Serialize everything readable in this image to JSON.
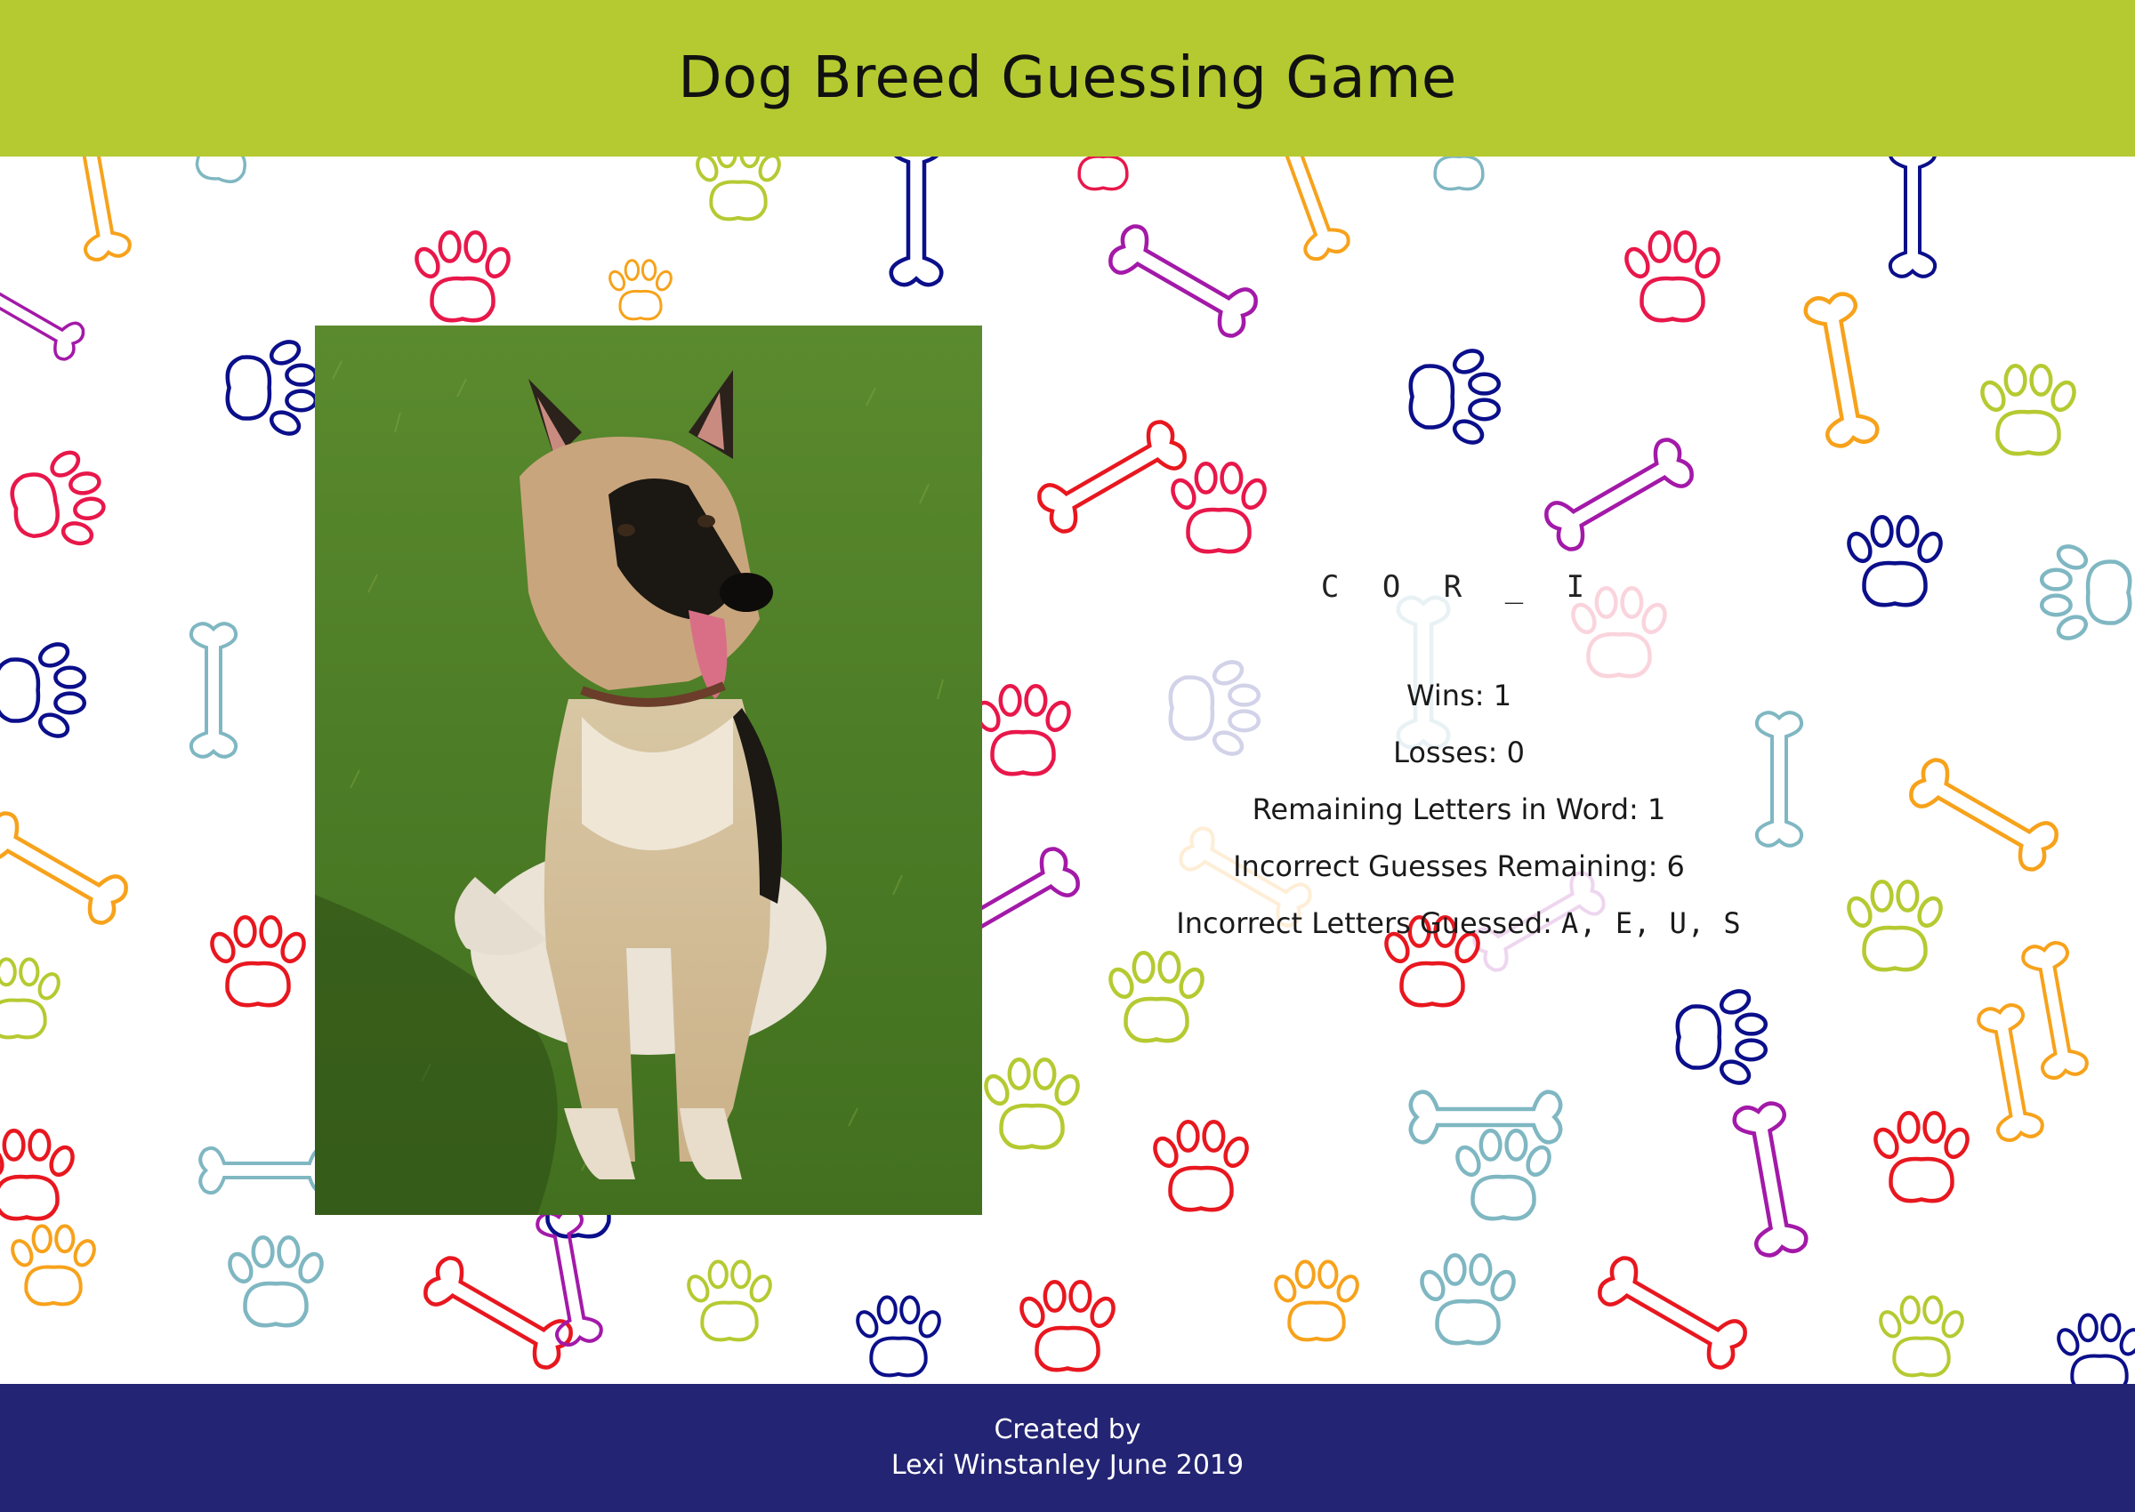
{
  "header": {
    "title": "Dog Breed Guessing Game"
  },
  "game": {
    "word_display": "C O R _ I",
    "wins_label": "Wins: ",
    "wins": "1",
    "losses_label": "Losses: ",
    "losses": "0",
    "remaining_letters_label": "Remaining Letters in Word: ",
    "remaining_letters": "1",
    "incorrect_remaining_label": "Incorrect Guesses Remaining: ",
    "incorrect_remaining": "6",
    "incorrect_letters_label": "Incorrect Letters Guessed: ",
    "incorrect_letters": "A, E, U, S"
  },
  "photo": {
    "subject": "german-shepherd-dog-sitting-on-grass"
  },
  "footer": {
    "line1": "Created by",
    "line2": "Lexi Winstanley June 2019"
  },
  "colors": {
    "header_bg": "#b5ca31",
    "footer_bg": "#232473",
    "pattern": [
      "#f7a21b",
      "#e8174a",
      "#b5ca31",
      "#0b0f8a",
      "#a319a8",
      "#7fb7c2",
      "#e8171f"
    ]
  }
}
